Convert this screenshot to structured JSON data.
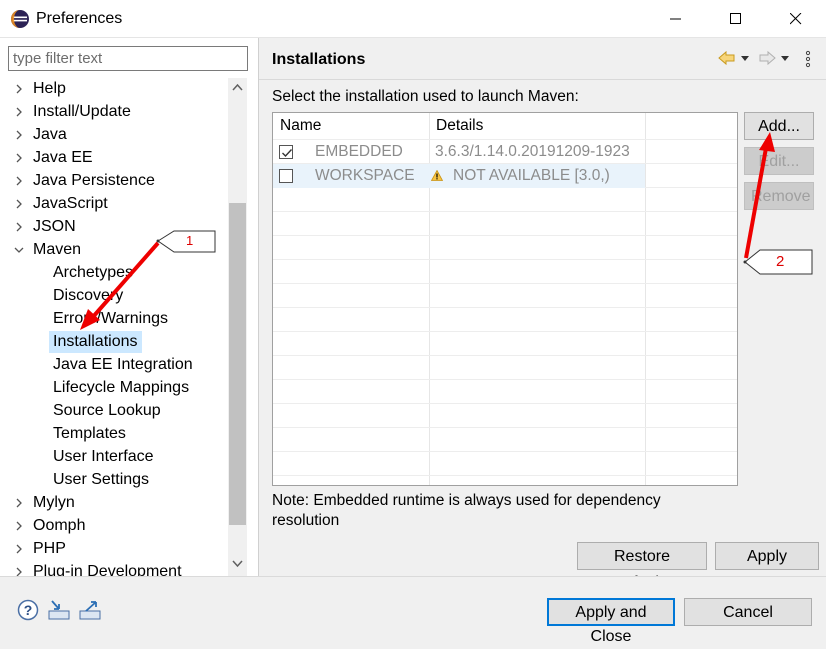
{
  "window": {
    "title": "Preferences"
  },
  "filter": {
    "placeholder": "type filter text"
  },
  "tree": {
    "top_items_before": [
      "Help",
      "Install/Update",
      "Java",
      "Java EE",
      "Java Persistence",
      "JavaScript",
      "JSON"
    ],
    "expanded": "Maven",
    "maven_children": [
      "Archetypes",
      "Discovery",
      "Errors/Warnings",
      "Installations",
      "Java EE Integration",
      "Lifecycle Mappings",
      "Source Lookup",
      "Templates",
      "User Interface",
      "User Settings"
    ],
    "selected": "Installations",
    "top_items_after": [
      "Mylyn",
      "Oomph",
      "PHP",
      "Plug-in Development"
    ]
  },
  "page": {
    "title": "Installations",
    "description": "Select the installation used to launch Maven:",
    "note": "Note: Embedded runtime is always used for dependency resolution"
  },
  "table": {
    "headers": {
      "name": "Name",
      "details": "Details"
    },
    "rows": [
      {
        "checked": true,
        "name": "EMBEDDED",
        "details": "3.6.3/1.14.0.20191209-1923",
        "warning": false
      },
      {
        "checked": false,
        "name": "WORKSPACE",
        "details": "NOT AVAILABLE [3.0,)",
        "warning": true
      }
    ]
  },
  "buttons": {
    "add": "Add...",
    "edit": "Edit...",
    "remove": "Remove",
    "restore_defaults": "Restore Defaults",
    "apply": "Apply",
    "apply_and_close": "Apply and Close",
    "cancel": "Cancel"
  },
  "annotations": {
    "callout_1": "1",
    "callout_2": "2"
  },
  "colors": {
    "selection": "#cce8ff",
    "accent": "#0078d7",
    "annotation": "#dd0000"
  }
}
